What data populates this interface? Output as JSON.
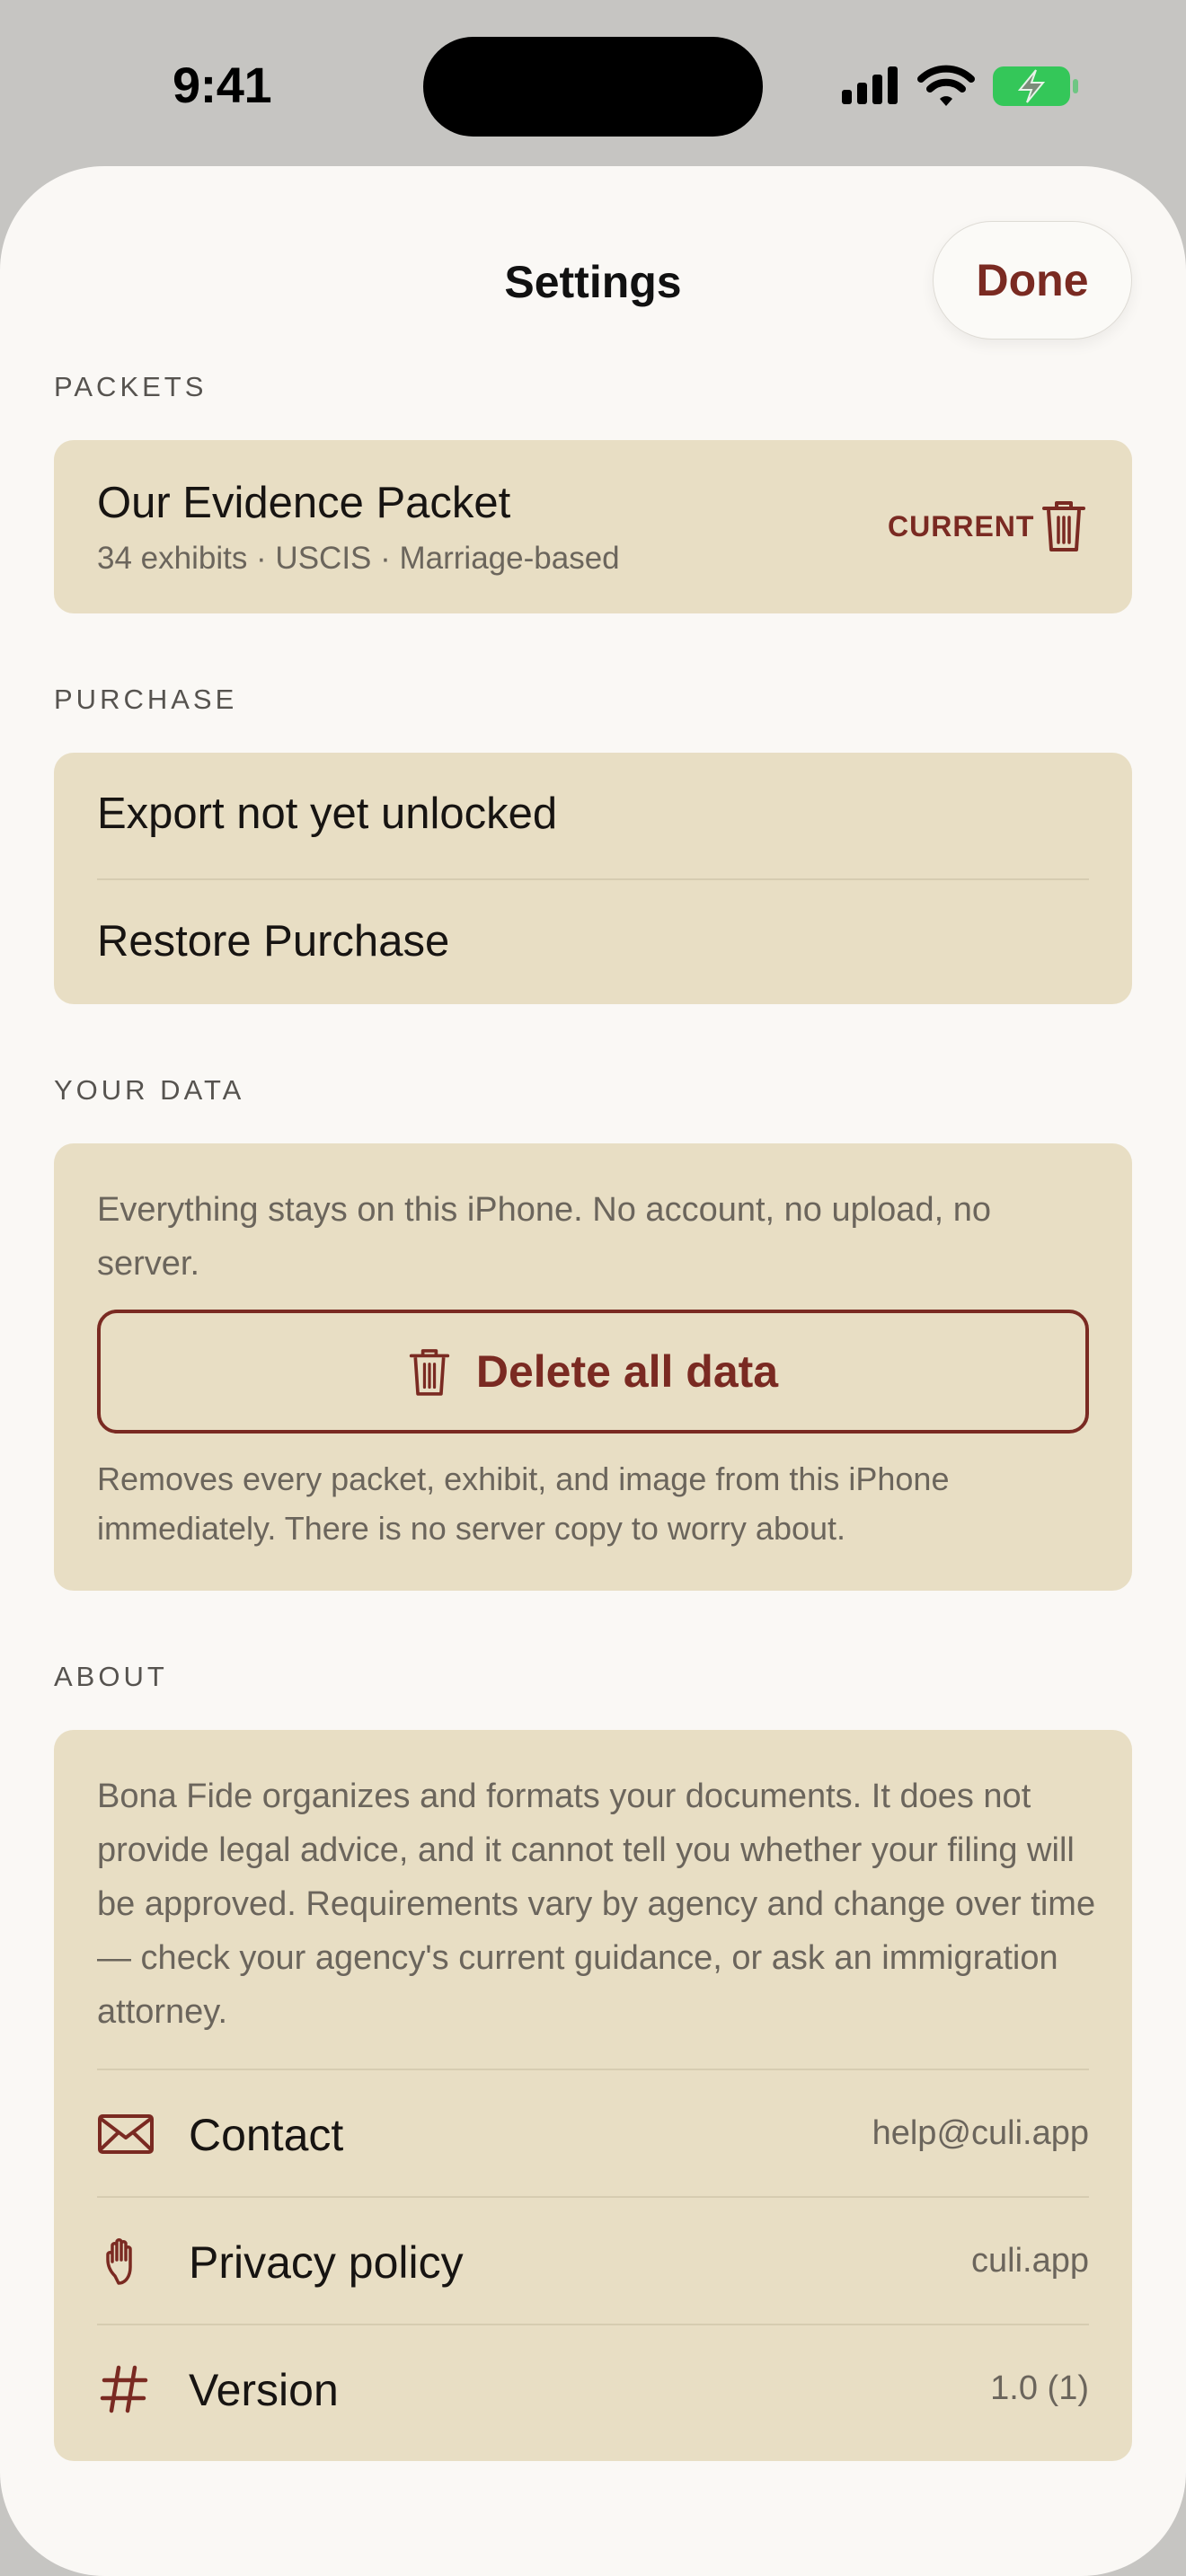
{
  "status_bar": {
    "time": "9:41"
  },
  "header": {
    "title": "Settings",
    "done_label": "Done"
  },
  "sections": {
    "packets": "PACKETS",
    "purchase": "PURCHASE",
    "your_data": "YOUR DATA",
    "about": "ABOUT"
  },
  "packet": {
    "title": "Our Evidence Packet",
    "subtitle": "34 exhibits · USCIS · Marriage-based",
    "badge": "CURRENT"
  },
  "purchase": {
    "status": "Export not yet unlocked",
    "restore": "Restore Purchase"
  },
  "your_data": {
    "description": "Everything stays on this iPhone. No account, no upload, no server.",
    "delete_label": "Delete all data",
    "delete_note": "Removes every packet, exhibit, and image from this iPhone immediately. There is no server copy to worry about."
  },
  "about": {
    "disclaimer": "Bona Fide organizes and formats your documents. It does not provide legal advice, and it cannot tell you whether your filing will be approved. Requirements vary by agency and change over time — check your agency's current guidance, or ask an immigration attorney.",
    "rows": [
      {
        "label": "Contact",
        "value": "help@culi.app",
        "icon": "envelope-icon"
      },
      {
        "label": "Privacy policy",
        "value": "culi.app",
        "icon": "hand-icon"
      },
      {
        "label": "Version",
        "value": "1.0 (1)",
        "icon": "hash-icon"
      }
    ]
  },
  "colors": {
    "accent": "#7a2a22",
    "card": "#e8dec4",
    "sheet": "#faf8f5",
    "battery": "#34c759"
  }
}
